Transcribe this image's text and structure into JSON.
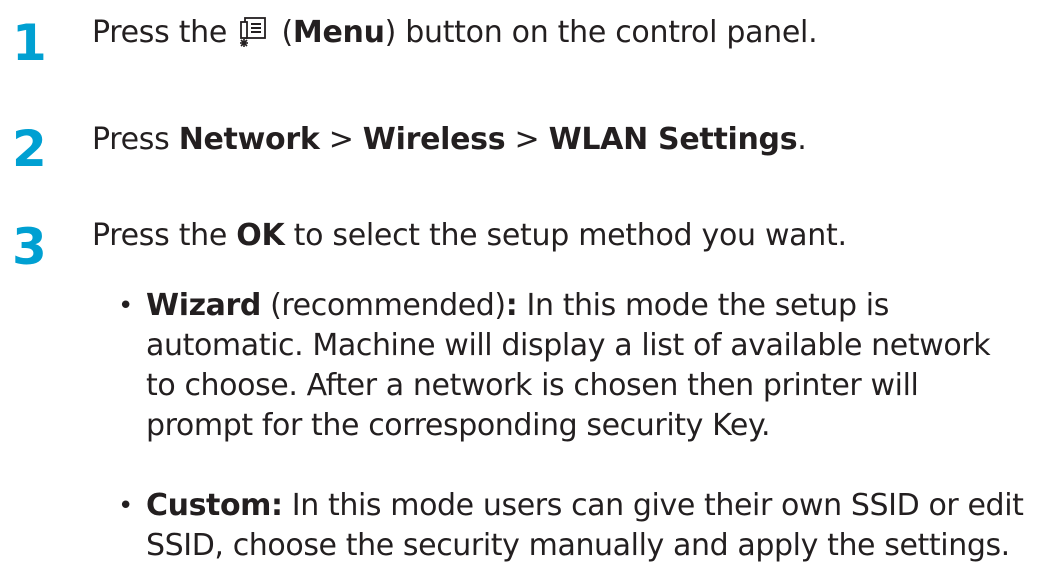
{
  "steps": [
    {
      "number": "1",
      "prefix": "Press the ",
      "icon": "menu-icon",
      "paren_open": " (",
      "bold": "Menu",
      "suffix": ") button on the control panel."
    },
    {
      "number": "2",
      "prefix": "Press ",
      "b1": "Network",
      "sep1": " > ",
      "b2": "Wireless",
      "sep2": " > ",
      "b3": "WLAN Settings",
      "suffix": "."
    },
    {
      "number": "3",
      "prefix": "Press the ",
      "bold": "OK",
      "suffix": " to select the setup method you want."
    }
  ],
  "bullets": [
    {
      "bullet": "•",
      "bold": "Wizard",
      "middle": " (recommended)",
      "colon": ":",
      "line1": " In this mode the setup is",
      "line2": "automatic. Machine will display a list of available network",
      "line3": "to choose. After a network is chosen then printer will",
      "line4": "prompt for the corresponding security Key."
    },
    {
      "bullet": "•",
      "bold": "Custom:",
      "line1": " In this mode users can give their own SSID or edit",
      "line2": "SSID, choose the security manually and apply the settings."
    }
  ],
  "colors": {
    "step_number": "#00a0d2",
    "text": "#231f20"
  }
}
